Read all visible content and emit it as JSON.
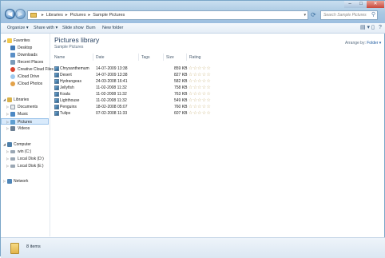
{
  "window": {
    "minimize_glyph": "–",
    "maximize_glyph": "□",
    "close_glyph": "✕",
    "back_glyph": "◀",
    "forward_glyph": "▶",
    "close_color": "#c9473a"
  },
  "address_bar": {
    "crumbs": [
      "Libraries",
      "Pictures",
      "Sample Pictures"
    ],
    "separator": "▸",
    "dropdown": "▾",
    "refresh_glyph": "⟳"
  },
  "search": {
    "placeholder": "Search Sample Pictures",
    "icon": "search-icon",
    "glyph": "⚲"
  },
  "toolbar": {
    "organize": "Organize ▾",
    "share_with": "Share with ▾",
    "slide_show": "Slide show",
    "burn": "Burn",
    "new_folder": "New folder",
    "views_glyph": "▤ ▾",
    "preview_glyph": "▯",
    "help_glyph": "?"
  },
  "nav": {
    "favorites": "Favorites",
    "desktop": "Desktop",
    "downloads": "Downloads",
    "recent_places": "Recent Places",
    "creative_cloud": "Creative Cloud Files",
    "icloud_drive": "iCloud Drive",
    "icloud_photos": "iCloud Photos",
    "libraries": "Libraries",
    "documents": "Documents",
    "music": "Music",
    "pictures": "Pictures",
    "videos": "Videos",
    "computer": "Computer",
    "win_c": "win (C:)",
    "local_d": "Local Disk (D:)",
    "local_e": "Local Disk (E:)",
    "network": "Network",
    "expand_glyph": "▷",
    "collapse_glyph": "◢"
  },
  "library": {
    "title": "Pictures library",
    "subtitle": "Sample Pictures",
    "arrange_label": "Arrange by:",
    "arrange_value": "Folder ▾"
  },
  "columns": {
    "name": "Name",
    "date": "Date",
    "tags": "Tags",
    "size": "Size",
    "rating": "Rating"
  },
  "files": [
    {
      "name": "Chrysanthemum",
      "date": "14-07-2009 13:38",
      "size": "859 KB",
      "stars": "☆☆☆☆☆"
    },
    {
      "name": "Desert",
      "date": "14-07-2009 13:38",
      "size": "827 KB",
      "stars": "☆☆☆☆☆"
    },
    {
      "name": "Hydrangeas",
      "date": "24-03-2008 16:41",
      "size": "582 KB",
      "stars": "☆☆☆☆☆"
    },
    {
      "name": "Jellyfish",
      "date": "11-02-2008 11:32",
      "size": "758 KB",
      "stars": "☆☆☆☆☆"
    },
    {
      "name": "Koala",
      "date": "11-02-2008 11:32",
      "size": "763 KB",
      "stars": "☆☆☆☆☆"
    },
    {
      "name": "Lighthouse",
      "date": "11-02-2008 11:32",
      "size": "549 KB",
      "stars": "☆☆☆☆☆"
    },
    {
      "name": "Penguins",
      "date": "18-02-2008 05:07",
      "size": "760 KB",
      "stars": "☆☆☆☆☆"
    },
    {
      "name": "Tulips",
      "date": "07-02-2008 11:33",
      "size": "607 KB",
      "stars": "☆☆☆☆☆"
    }
  ],
  "status": {
    "count": "8 items"
  }
}
